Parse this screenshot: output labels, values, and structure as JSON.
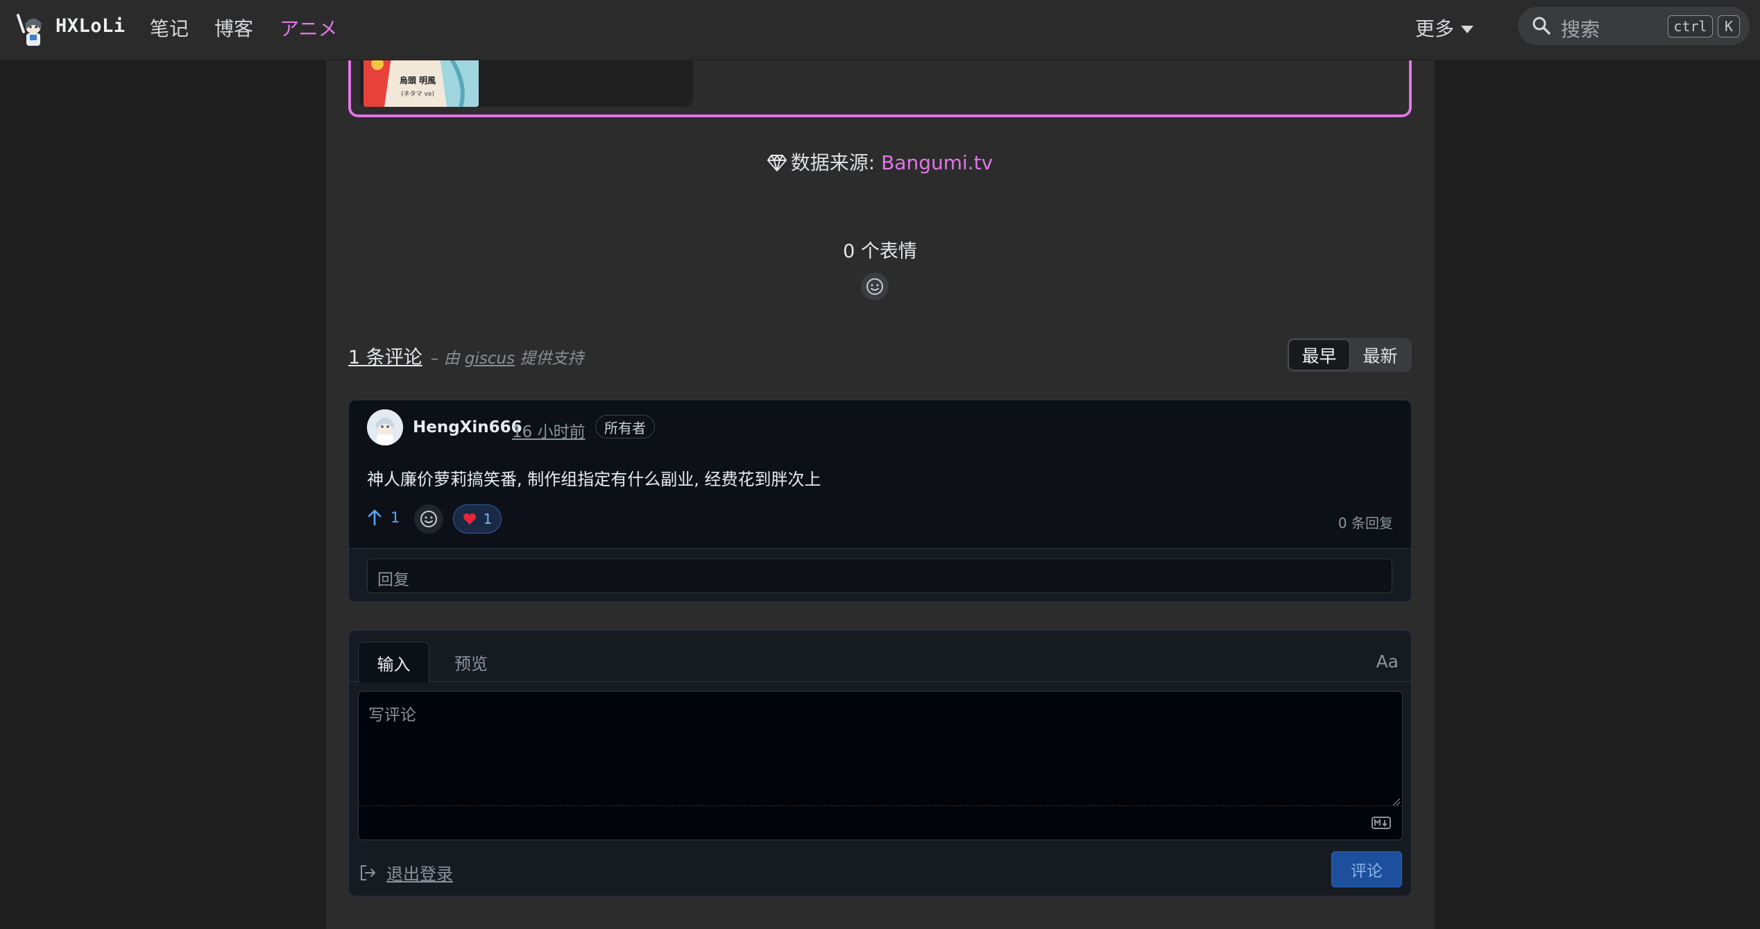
{
  "nav": {
    "brand": "HXLoLi",
    "links": [
      "笔记",
      "博客",
      "アニメ"
    ],
    "more_label": "更多",
    "search_placeholder": "搜索",
    "kbd_ctrl": "ctrl",
    "kbd_k": "K"
  },
  "source": {
    "label": "数据来源: ",
    "link_text": "Bangumi.tv"
  },
  "reactions": {
    "count_text": "0 个表情"
  },
  "comments": {
    "count_text": "1 条评论",
    "by_prefix": "– 由 ",
    "by_link": "giscus",
    "by_suffix": " 提供支持",
    "sort_oldest": "最早",
    "sort_newest": "最新",
    "items": [
      {
        "author": "HengXin666",
        "time": "16 小时前",
        "badge": "所有者",
        "body": "神人廉价萝莉搞笑番, 制作组指定有什么副业, 经费花到胖次上",
        "upvotes": "1",
        "hearts": "1",
        "replies": "0 条回复",
        "reply_placeholder": "回复"
      }
    ]
  },
  "editor": {
    "tab_write": "输入",
    "tab_preview": "预览",
    "format_label": "Aa",
    "placeholder": "写评论",
    "logout": "退出登录",
    "submit": "评论"
  },
  "cover_text": {
    "line1": "烏頭 明風",
    "line2": "(ネタマ ve)"
  },
  "colors": {
    "accent": "#e077e6",
    "nav_bg": "#2b2b2b",
    "page_bg": "#1f1f1f",
    "panel_bg": "#2c2c2c",
    "giscus_bg": "#0d1117",
    "link_blue": "#58a6ff"
  }
}
